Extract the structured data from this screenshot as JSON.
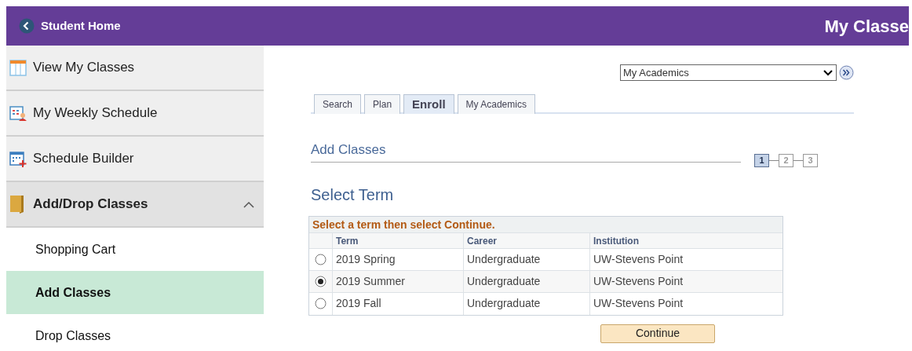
{
  "header": {
    "back_label": "Student Home",
    "title": "My Classe"
  },
  "sidebar": {
    "items": [
      {
        "label": "View My Classes",
        "kind": "view",
        "selected": false
      },
      {
        "label": "My Weekly Schedule",
        "kind": "weekly",
        "selected": false
      },
      {
        "label": "Schedule Builder",
        "kind": "builder",
        "selected": false
      },
      {
        "label": "Add/Drop Classes",
        "kind": "folder",
        "expanded": true,
        "selected": false,
        "children": [
          {
            "label": "Shopping Cart",
            "selected": false
          },
          {
            "label": "Add Classes",
            "selected": true
          },
          {
            "label": "Drop Classes",
            "selected": false
          }
        ]
      }
    ]
  },
  "nav_select": {
    "value": "My Academics"
  },
  "tabs": [
    {
      "label": "Search",
      "selected": false
    },
    {
      "label": "Plan",
      "selected": false
    },
    {
      "label": "Enroll",
      "selected": true
    },
    {
      "label": "My Academics",
      "selected": false
    }
  ],
  "section_title": "Add Classes",
  "steps": [
    {
      "label": "1",
      "selected": true
    },
    {
      "label": "2",
      "selected": false
    },
    {
      "label": "3",
      "selected": false
    }
  ],
  "page_title": "Select Term",
  "table": {
    "instruction": "Select a term then select Continue.",
    "columns": [
      "Term",
      "Career",
      "Institution"
    ],
    "rows": [
      {
        "selected": false,
        "cells": [
          "2019 Spring",
          "Undergraduate",
          "UW-Stevens Point"
        ]
      },
      {
        "selected": true,
        "cells": [
          "2019 Summer",
          "Undergraduate",
          "UW-Stevens Point"
        ]
      },
      {
        "selected": false,
        "cells": [
          "2019 Fall",
          "Undergraduate",
          "UW-Stevens Point"
        ]
      }
    ]
  },
  "continue_button": "Continue"
}
